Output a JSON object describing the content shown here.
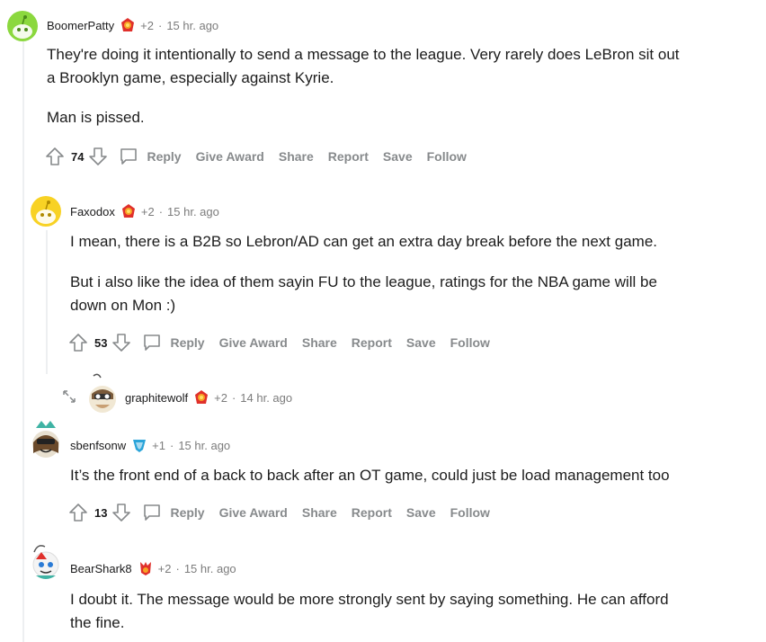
{
  "comments": [
    {
      "author": "BoomerPatty",
      "plus": "+2",
      "time": "15 hr. ago",
      "paragraphs": [
        [
          "They're doing it intentionally to send a message to the league. Very rarely does LeBron sit out",
          "a Brooklyn game, especially against Kyrie."
        ],
        [
          "Man is pissed."
        ]
      ],
      "score": "74"
    },
    {
      "author": "Faxodox",
      "plus": "+2",
      "time": "15 hr. ago",
      "paragraphs": [
        [
          "I mean, there is a B2B so Lebron/AD can get an extra day break before the next game."
        ],
        [
          "But i also like the idea of them sayin FU to the league, ratings for the NBA game will be",
          "down on Mon :)"
        ]
      ],
      "score": "53"
    },
    {
      "author": "graphitewolf",
      "plus": "+2",
      "time": "14 hr. ago",
      "collapsed": true
    },
    {
      "author": "sbenfsonw",
      "plus": "+1",
      "time": "15 hr. ago",
      "paragraphs": [
        [
          "It’s the front end of a back to back after an OT game, could just be load management too"
        ]
      ],
      "score": "13"
    },
    {
      "author": "BearShark8",
      "plus": "+2",
      "time": "15 hr. ago",
      "paragraphs": [
        [
          "I doubt it. The message would be more strongly sent by saying something. He can afford",
          "the fine."
        ]
      ]
    }
  ],
  "actions": {
    "reply": "Reply",
    "give_award": "Give Award",
    "share": "Share",
    "report": "Report",
    "save": "Save",
    "follow": "Follow"
  },
  "icons": {
    "upvote": "upvote-arrow-icon",
    "downvote": "downvote-arrow-icon",
    "reply": "speech-bubble-icon",
    "flair": "award-flair-icon",
    "expand": "expand-arrows-icon"
  },
  "colors": {
    "meta_gray": "#7c7c7c",
    "action_gray": "#878a8c",
    "thread_line": "#edeff1",
    "avatar_green": "#8bd83e",
    "avatar_yellow": "#f8d224",
    "flair_red": "#e0302b",
    "flair_orange": "#f7a224"
  }
}
